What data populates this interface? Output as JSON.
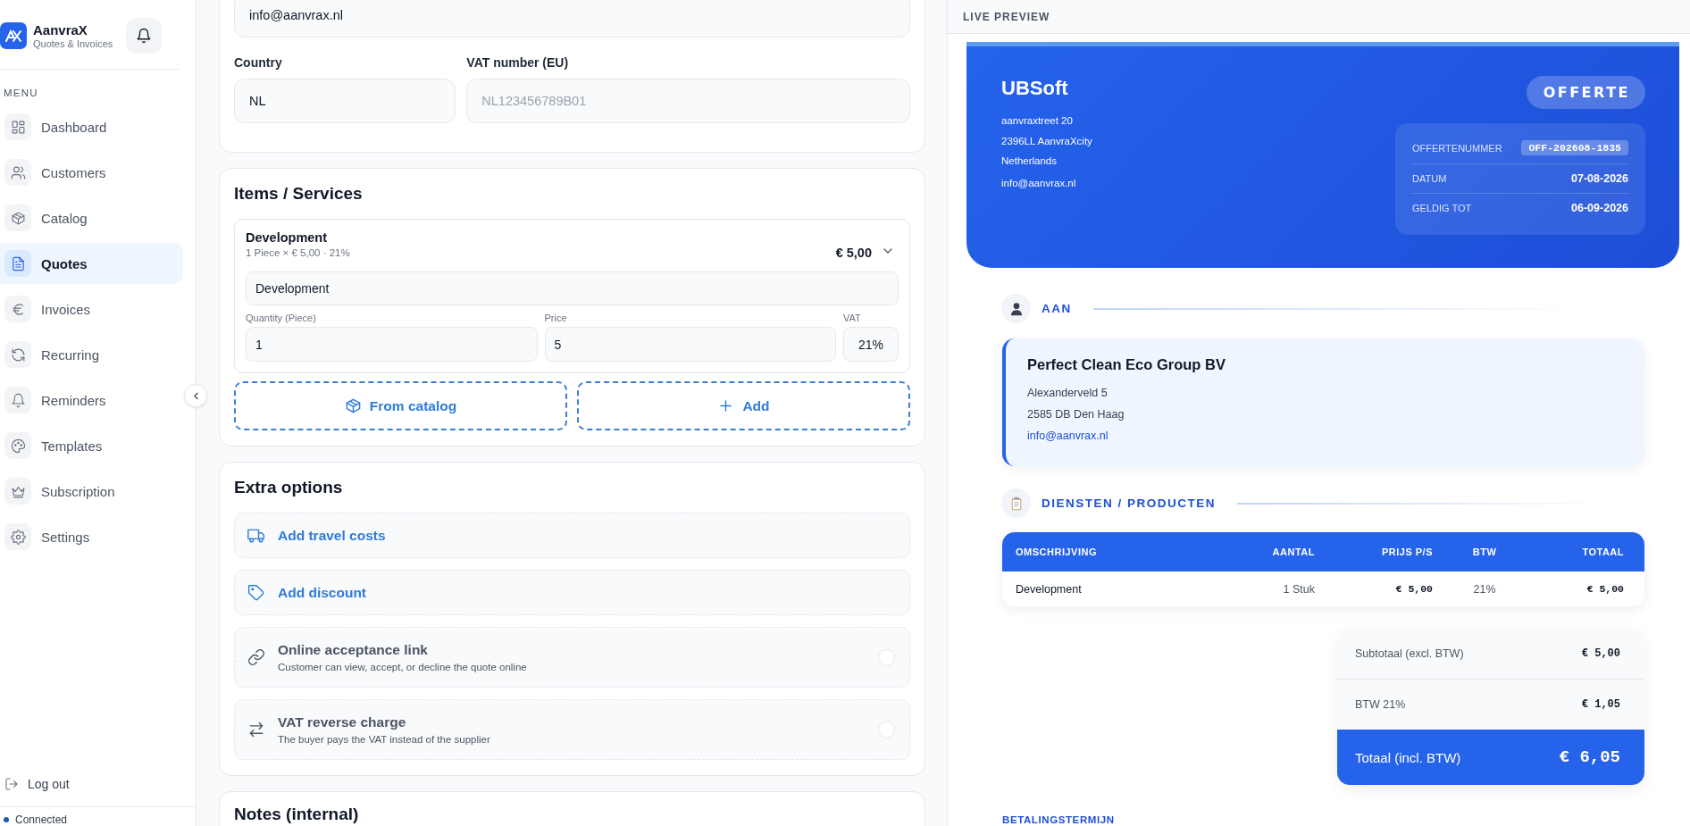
{
  "sidebar": {
    "brand": {
      "name": "AanvraX",
      "tagline": "Quotes & Invoices"
    },
    "menu_heading": "MENU",
    "items": [
      {
        "label": "Dashboard",
        "selected": false
      },
      {
        "label": "Customers",
        "selected": false
      },
      {
        "label": "Catalog",
        "selected": false
      },
      {
        "label": "Quotes",
        "selected": true
      },
      {
        "label": "Invoices",
        "selected": false
      },
      {
        "label": "Recurring",
        "selected": false
      },
      {
        "label": "Reminders",
        "selected": false
      },
      {
        "label": "Templates",
        "selected": false
      },
      {
        "label": "Subscription",
        "selected": false
      },
      {
        "label": "Settings",
        "selected": false
      }
    ],
    "logout": "Log out",
    "status": "Connected"
  },
  "form": {
    "email_field": {
      "value": "info@aanvrax.nl"
    },
    "country": {
      "label": "Country",
      "value": "NL"
    },
    "vat_number": {
      "label": "VAT number (EU)",
      "placeholder": "NL123456789B01"
    },
    "items_section": {
      "title": "Items / Services",
      "items": [
        {
          "name": "Development",
          "summary": "1 Piece × € 5,00 · 21%",
          "total": "€ 5,00",
          "expanded": true,
          "description": "Development",
          "quantity_label": "Quantity (Piece)",
          "quantity": "1",
          "price_label": "Price",
          "price": "5",
          "vat_label": "VAT",
          "vat": "21%"
        }
      ],
      "buttons": [
        "From catalog",
        "Add"
      ]
    },
    "extra_options": {
      "title": "Extra options",
      "options": [
        {
          "kind": "action",
          "label": "Add travel costs"
        },
        {
          "kind": "action",
          "label": "Add discount"
        },
        {
          "kind": "toggle",
          "label": "Online acceptance link",
          "description": "Customer can view, accept, or decline the quote online",
          "checked": false
        },
        {
          "kind": "toggle",
          "label": "VAT reverse charge",
          "description": "The buyer pays the VAT instead of the supplier",
          "checked": false
        }
      ]
    },
    "notes_section": {
      "title": "Notes (internal)"
    }
  },
  "preview": {
    "header": "LIVE PREVIEW",
    "company": {
      "name": "UBSoft",
      "address_lines": [
        "aanvraxtreet 20",
        "2396LL AanvraXcity",
        "Netherlands"
      ],
      "email": "info@aanvrax.nl"
    },
    "doc_type": "OFFERTE",
    "meta": [
      {
        "label": "OFFERTENUMMER",
        "value": "OFF-202608-1835",
        "kind": "code"
      },
      {
        "label": "DATUM",
        "value": "07-08-2026",
        "kind": "plain"
      },
      {
        "label": "GELDIG TOT",
        "value": "06-09-2026",
        "kind": "plain"
      }
    ],
    "recipient_section": {
      "title": "AAN",
      "name": "Perfect Clean Eco Group BV",
      "address_lines": [
        "Alexanderveld 5",
        "2585 DB Den Haag"
      ],
      "email": "info@aanvrax.nl"
    },
    "items_section": {
      "title": "DIENSTEN / PRODUCTEN",
      "table": {
        "columns": [
          "OMSCHRIJVING",
          "AANTAL",
          "PRIJS P/S",
          "BTW",
          "TOTAAL"
        ],
        "rows": [
          [
            "Development",
            "1 Stuk",
            "€ 5,00",
            "21%",
            "€ 5,00"
          ]
        ]
      }
    },
    "totals": [
      {
        "label": "Subtotaal (excl. BTW)",
        "value": "€ 5,00"
      },
      {
        "label": "BTW 21%",
        "value": "€ 1,05"
      }
    ],
    "grand_total": {
      "label": "Totaal (incl. BTW)",
      "value": "€ 6,05"
    },
    "payment_terms_title": "BETALINGSTERMIJN"
  }
}
